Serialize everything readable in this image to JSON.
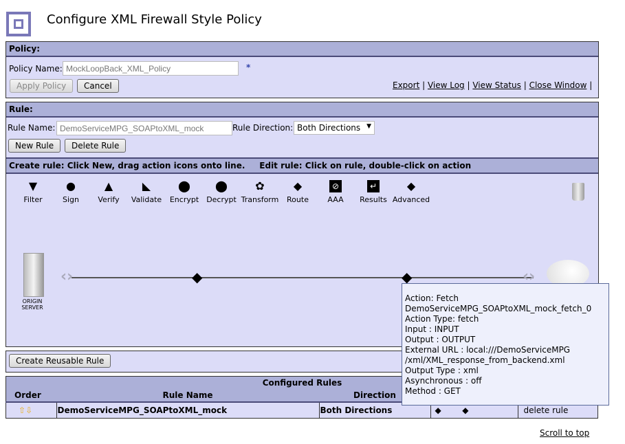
{
  "page": {
    "title": "Configure XML Firewall Style Policy"
  },
  "policy": {
    "header": "Policy:",
    "name_label": "Policy Name:",
    "name_value": "MockLoopBack_XML_Policy",
    "required_marker": "*",
    "apply_label": "Apply Policy",
    "cancel_label": "Cancel",
    "links": [
      "Export",
      "View Log",
      "View Status",
      "Close Window"
    ]
  },
  "rule": {
    "header": "Rule:",
    "name_label": "Rule Name:",
    "name_value": "DemoServiceMPG_SOAPtoXML_mock",
    "direction_label": "Rule Direction:",
    "direction_value": "Both Directions",
    "new_label": "New Rule",
    "delete_label": "Delete Rule",
    "instructions": "Create rule: Click New, drag action icons onto line.     Edit rule: Click on rule, double-click on action"
  },
  "actions": [
    {
      "label": "Filter",
      "icon": "filter-icon"
    },
    {
      "label": "Sign",
      "icon": "sign-icon"
    },
    {
      "label": "Verify",
      "icon": "verify-icon"
    },
    {
      "label": "Validate",
      "icon": "validate-icon"
    },
    {
      "label": "Encrypt",
      "icon": "encrypt-icon"
    },
    {
      "label": "Decrypt",
      "icon": "decrypt-icon"
    },
    {
      "label": "Transform",
      "icon": "transform-icon"
    },
    {
      "label": "Route",
      "icon": "route-icon"
    },
    {
      "label": "AAA",
      "icon": "aaa-icon"
    },
    {
      "label": "Results",
      "icon": "results-icon"
    },
    {
      "label": "Advanced",
      "icon": "advanced-icon"
    }
  ],
  "canvas": {
    "server_label_1": "ORIGIN",
    "server_label_2": "SERVER"
  },
  "tooltip": {
    "lines": [
      "Action: Fetch",
      "DemoServiceMPG_SOAPtoXML_mock_fetch_0",
      "Action Type: fetch",
      "Input : INPUT",
      "Output : OUTPUT",
      "External URL : local:///DemoServiceMPG",
      "/xml/XML_response_from_backend.xml",
      "Output Type : xml",
      "Asynchronous : off",
      "Method : GET"
    ]
  },
  "reusable_label": "Create Reusable Rule",
  "configured": {
    "title": "Configured Rules",
    "columns": [
      "Order",
      "Rule Name",
      "Direction"
    ],
    "rows": [
      {
        "name": "DemoServiceMPG_SOAPtoXML_mock",
        "direction": "Both Directions",
        "delete": "delete rule"
      }
    ]
  },
  "scroll_top": "Scroll to top"
}
